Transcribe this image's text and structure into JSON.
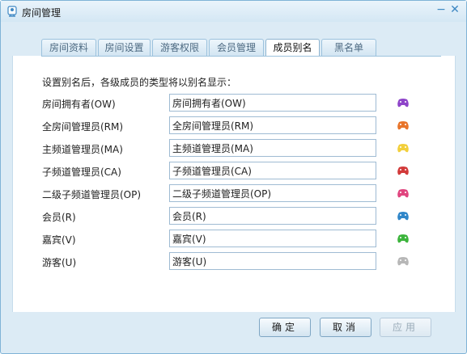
{
  "window": {
    "title": "房间管理",
    "minimize_glyph": "−",
    "close_glyph": "✕"
  },
  "tabs": [
    {
      "label": "房间资料",
      "active": false
    },
    {
      "label": "房间设置",
      "active": false
    },
    {
      "label": "游客权限",
      "active": false
    },
    {
      "label": "会员管理",
      "active": false
    },
    {
      "label": "成员别名",
      "active": true
    },
    {
      "label": "黑名单",
      "active": false
    }
  ],
  "panel": {
    "intro": "设置别名后，各级成员的类型将以别名显示：",
    "rows": [
      {
        "label": "房间拥有者(OW)",
        "value": "房间拥有者(OW)",
        "icon": "gamepad-icon",
        "color": "#8e44c9"
      },
      {
        "label": "全房间管理员(RM)",
        "value": "全房间管理员(RM)",
        "icon": "gamepad-icon",
        "color": "#e8742a"
      },
      {
        "label": "主频道管理员(MA)",
        "value": "主频道管理员(MA)",
        "icon": "gamepad-icon",
        "color": "#f2cf3b"
      },
      {
        "label": "子频道管理员(CA)",
        "value": "子频道管理员(CA)",
        "icon": "gamepad-icon",
        "color": "#d23a3a"
      },
      {
        "label": "二级子频道管理员(OP)",
        "value": "二级子频道管理员(OP)",
        "icon": "gamepad-icon",
        "color": "#e0457f"
      },
      {
        "label": "会员(R)",
        "value": "会员(R)",
        "icon": "gamepad-icon",
        "color": "#2f86c9"
      },
      {
        "label": "嘉宾(V)",
        "value": "嘉宾(V)",
        "icon": "gamepad-icon",
        "color": "#3cb43c"
      },
      {
        "label": "游客(U)",
        "value": "游客(U)",
        "icon": "gamepad-icon",
        "color": "#b7b7b7"
      }
    ]
  },
  "footer": {
    "ok_label": "确定",
    "cancel_label": "取消",
    "apply_label": "应用"
  }
}
